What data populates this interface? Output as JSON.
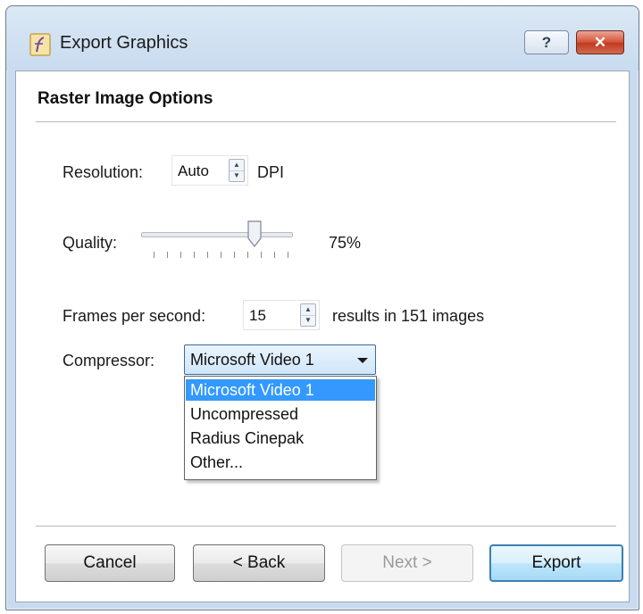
{
  "window": {
    "title": "Export Graphics",
    "help_label": "?",
    "close_label": "✕"
  },
  "section": {
    "title": "Raster Image Options"
  },
  "resolution": {
    "label": "Resolution:",
    "value": "Auto",
    "unit": "DPI"
  },
  "quality": {
    "label": "Quality:",
    "value_text": "75%",
    "value_fraction": 0.75
  },
  "frames": {
    "label": "Frames per second:",
    "value": "15",
    "result_text": "results in 151 images"
  },
  "compressor": {
    "label": "Compressor:",
    "selected": "Microsoft Video 1",
    "options": [
      "Microsoft Video 1",
      "Uncompressed",
      "Radius Cinepak",
      "Other..."
    ]
  },
  "buttons": {
    "cancel": "Cancel",
    "back": "< Back",
    "next": "Next >",
    "export": "Export"
  },
  "colors": {
    "selection": "#3399ff",
    "close_button": "#c13b22"
  }
}
